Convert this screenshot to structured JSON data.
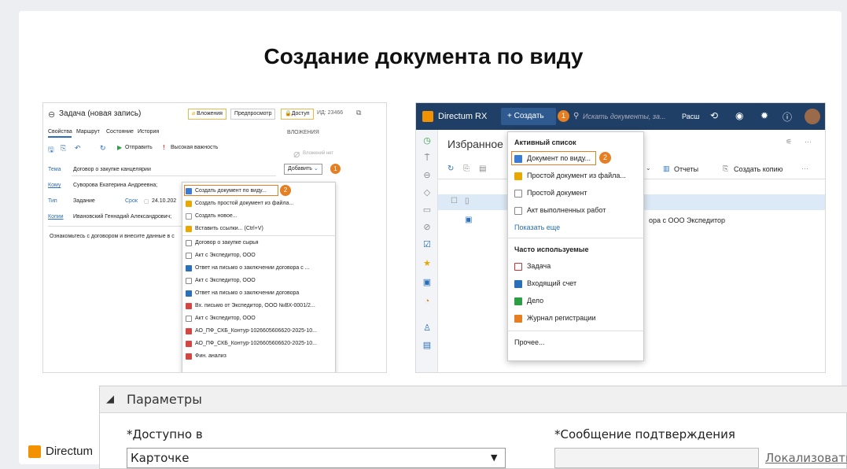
{
  "slide": {
    "title": "Создание документа по виду",
    "footer_brand": "Directum"
  },
  "left_shot": {
    "window_title": "Задача (новая запись)",
    "attachments_btn": "Вложения",
    "preview_btn": "Предпросмотр",
    "access_btn": "Доступ",
    "id_label": "ИД: 23466",
    "tabs": [
      "Свойства",
      "Маршрут",
      "Состояние",
      "История"
    ],
    "send_btn": "Отправить",
    "importance": "Высокая важность",
    "attachments_header": "ВЛОЖЕНИЯ",
    "no_attachments": "Вложений нет",
    "add_btn": "Добавить",
    "badge1": "1",
    "badge2": "2",
    "fields": {
      "subject_label": "Тема",
      "subject_value": "Договор о закупке канцелярии",
      "to_label": "Кому",
      "to_value": "Суворова Екатерина Андреевна;",
      "type_label": "Тип",
      "type_value": "Задание",
      "due_label": "Срок",
      "due_value": "24.10.202",
      "copies_label": "Копии",
      "copies_value": "Ивановский Геннадий Александрович;"
    },
    "body_text": "Ознакомьтесь с договором и внесите данные в с",
    "menu_items": [
      "Создать документ по виду...",
      "Создать простой документ из файла...",
      "Создать новое...",
      "Вставить ссылки... (Ctrl+V)",
      "Договор о закупке сырья",
      "Акт с Экспедитор, ООО",
      "Ответ на письмо о заключении договора с ...",
      "Акт с Экспедитор, ООО",
      "Ответ на письмо о заключении договора",
      "Вх. письмо от Экспедитор, ООО №ВХ-0001/2...",
      "Акт с Экспедитор, ООО",
      "АО_ПФ_СКБ_Контур-1026605606620-2025-10...",
      "АО_ПФ_СКБ_Контур-1026605606620-2025-10...",
      "Фин. анализ"
    ]
  },
  "right_shot": {
    "app_name": "Directum RX",
    "create_btn": "+ Создать",
    "search_placeholder": "Искать документы, за...",
    "ext_label": "Расш",
    "page_title": "Избранное",
    "reports_btn": "Отчеты",
    "copy_btn": "Создать копию",
    "row_text": "ора с ООО Экспедитор",
    "badge1": "1",
    "badge2": "2",
    "active_list_header": "Активный список",
    "active_items": [
      "Документ по виду...",
      "Простой документ из файла...",
      "Простой документ",
      "Акт выполненных работ"
    ],
    "show_more": "Показать еще",
    "frequent_header": "Часто используемые",
    "frequent_items": [
      "Задача",
      "Входящий счет",
      "Дело",
      "Журнал регистрации"
    ],
    "other": "Прочее..."
  },
  "params": {
    "header": "Параметры",
    "available_label": "*Доступно в",
    "available_value": "Карточке",
    "confirm_label": "*Сообщение подтверждения",
    "localize_link": "Локализовать"
  },
  "colors": {
    "accent_orange": "#e67e22",
    "topbar_navy": "#1f3f66",
    "link_blue": "#2a6fb7"
  }
}
